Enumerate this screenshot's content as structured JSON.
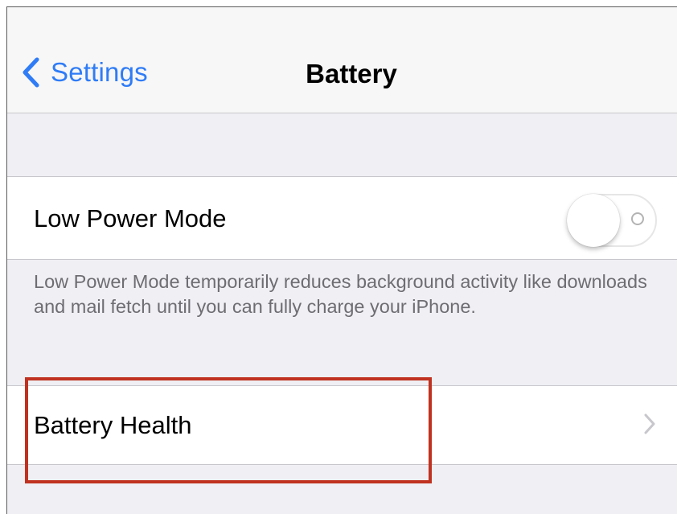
{
  "navbar": {
    "back_label": "Settings",
    "title": "Battery"
  },
  "low_power_mode": {
    "label": "Low Power Mode",
    "toggle_on": false
  },
  "low_power_footer": "Low Power Mode temporarily reduces background activity like downloads and mail fetch until you can fully charge your iPhone.",
  "battery_health": {
    "label": "Battery Health"
  },
  "colors": {
    "accent": "#2f7cf6",
    "highlight": "#c0321f",
    "background": "#efeff4"
  },
  "icons": {
    "back": "chevron-left-icon",
    "disclosure": "chevron-right-icon"
  }
}
